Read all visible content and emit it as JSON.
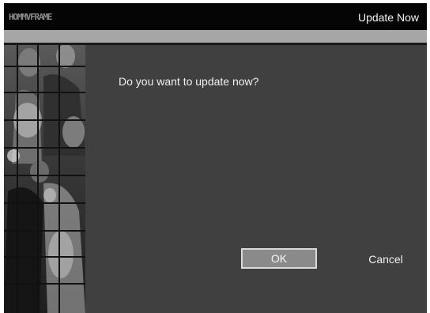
{
  "header": {
    "brand": "HOMMVFRAME",
    "title": "Update Now"
  },
  "sidebar": {
    "image": "wedding-photo-mosaic"
  },
  "dialog": {
    "message": "Do you want to update now?",
    "ok_label": "OK",
    "cancel_label": "Cancel"
  },
  "colors": {
    "background": "#404040",
    "topbar": "#050505",
    "strip": "#a6a6a6",
    "ok_button": "#8a8a8a",
    "text": "#f0f0f0"
  }
}
